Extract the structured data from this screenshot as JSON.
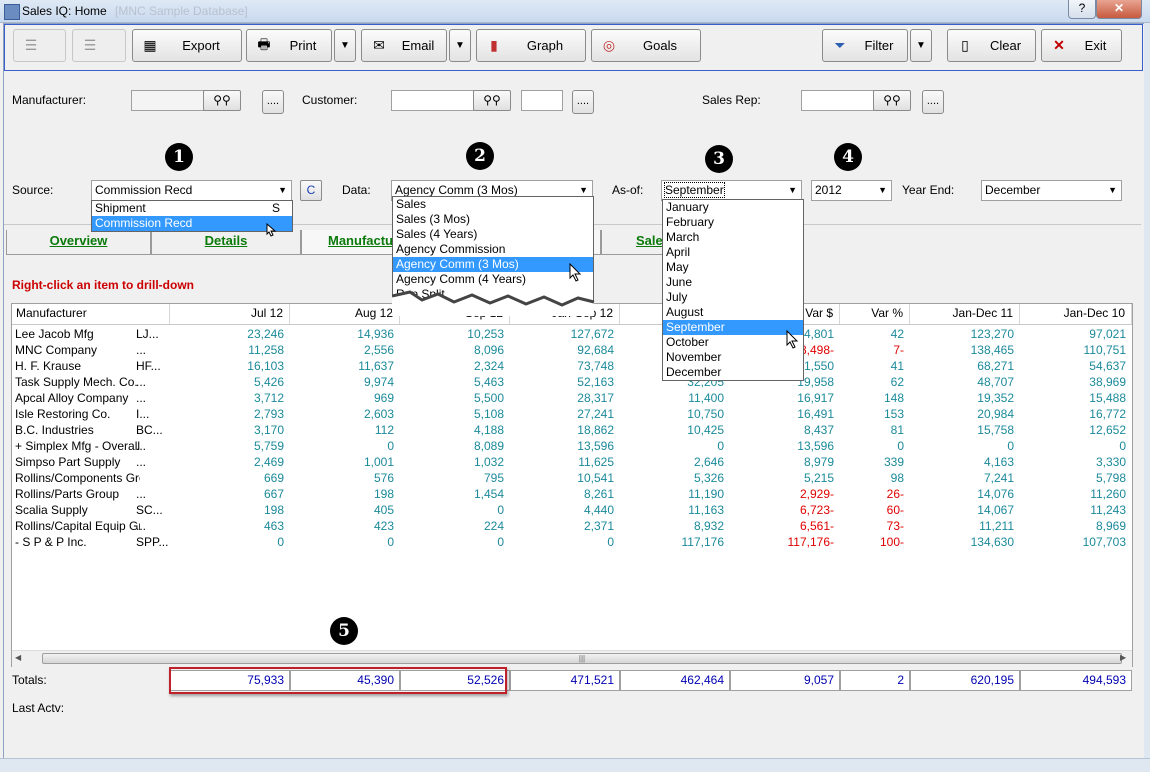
{
  "window": {
    "title": "Sales IQ: Home",
    "title_ghost": "[MNC Sample Database]",
    "help_btn": "?",
    "minimize_btn": "–",
    "close_btn": "✕"
  },
  "toolbar": {
    "export": "Export",
    "print": "Print",
    "email": "Email",
    "graph": "Graph",
    "goals": "Goals",
    "filter": "Filter",
    "clear": "Clear",
    "exit": "Exit",
    "dropdown_arrow": "▼"
  },
  "lookup": {
    "manufacturer_label": "Manufacturer:",
    "customer_label": "Customer:",
    "sales_rep_label": "Sales Rep:",
    "dots": "...."
  },
  "callouts": [
    "1",
    "2",
    "3",
    "4",
    "5"
  ],
  "source": {
    "label": "Source:",
    "value": "Commission Recd",
    "c_button": "C",
    "options": [
      {
        "label": "Shipment",
        "code": "S",
        "selected": false
      },
      {
        "label": "Commission Recd",
        "code": "",
        "selected": true
      }
    ]
  },
  "data_select": {
    "label": "Data:",
    "value": "Agency Comm (3 Mos)",
    "options": [
      "Sales",
      "Sales (3 Mos)",
      "Sales (4 Years)",
      "Agency Commission",
      "Agency Comm (3 Mos)",
      "Agency Comm (4 Years)",
      "Rep Split"
    ],
    "selected_index": 4
  },
  "asof": {
    "label": "As-of:",
    "value": "September",
    "options": [
      "January",
      "February",
      "March",
      "April",
      "May",
      "June",
      "July",
      "August",
      "September",
      "October",
      "November",
      "December"
    ],
    "selected_index": 8
  },
  "year": {
    "value": "2012"
  },
  "year_end": {
    "label": "Year End:",
    "value": "December"
  },
  "tabs": [
    "Overview",
    "Details",
    "Manufacturers",
    "Sales"
  ],
  "hint": "Right-click an item to drill-down",
  "grid": {
    "headers": [
      "Manufacturer",
      "Jul 12",
      "Aug 12",
      "Sep 12",
      "Jan-Sep 12",
      "Jan-Sep 11",
      "Var $",
      "Var %",
      "Jan-Dec 11",
      "Jan-Dec 10"
    ],
    "rows": [
      {
        "name": "Lee Jacob Mfg",
        "code": "LJ...",
        "v": [
          "23,246",
          "14,936",
          "10,253",
          "127,672",
          "",
          "4,801",
          "42",
          "123,270",
          "97,021"
        ],
        "neg": [
          false,
          false,
          false,
          false,
          false,
          false,
          false,
          false,
          false
        ]
      },
      {
        "name": "MNC Company",
        "code": "...",
        "v": [
          "11,258",
          "2,556",
          "8,096",
          "92,684",
          "",
          "8,498-",
          "7-",
          "138,465",
          "110,751"
        ],
        "neg": [
          false,
          false,
          false,
          false,
          false,
          true,
          true,
          false,
          false
        ]
      },
      {
        "name": "H. F. Krause",
        "code": "HF...",
        "v": [
          "16,103",
          "11,637",
          "2,324",
          "73,748",
          "",
          "21,550",
          "41",
          "68,271",
          "54,637"
        ],
        "neg": [
          false,
          false,
          false,
          false,
          false,
          false,
          false,
          false,
          false
        ]
      },
      {
        "name": "Task Supply Mech. Co.",
        "code": "...",
        "v": [
          "5,426",
          "9,974",
          "5,463",
          "52,163",
          "32,205",
          "19,958",
          "62",
          "48,707",
          "38,969"
        ],
        "neg": [
          false,
          false,
          false,
          false,
          false,
          false,
          false,
          false,
          false
        ]
      },
      {
        "name": "Apcal Alloy Company",
        "code": "...",
        "v": [
          "3,712",
          "969",
          "5,500",
          "28,317",
          "11,400",
          "16,917",
          "148",
          "19,352",
          "15,488"
        ],
        "neg": [
          false,
          false,
          false,
          false,
          false,
          false,
          false,
          false,
          false
        ]
      },
      {
        "name": "Isle Restoring Co.",
        "code": "I...",
        "v": [
          "2,793",
          "2,603",
          "5,108",
          "27,241",
          "10,750",
          "16,491",
          "153",
          "20,984",
          "16,772"
        ],
        "neg": [
          false,
          false,
          false,
          false,
          false,
          false,
          false,
          false,
          false
        ]
      },
      {
        "name": "B.C. Industries",
        "code": "BC...",
        "v": [
          "3,170",
          "112",
          "4,188",
          "18,862",
          "10,425",
          "8,437",
          "81",
          "15,758",
          "12,652"
        ],
        "neg": [
          false,
          false,
          false,
          false,
          false,
          false,
          false,
          false,
          false
        ]
      },
      {
        "name": " + Simplex Mfg - Overall",
        "code": "...",
        "v": [
          "5,759",
          "0",
          "8,089",
          "13,596",
          "0",
          "13,596",
          "0",
          "0",
          "0"
        ],
        "neg": [
          false,
          false,
          false,
          false,
          false,
          false,
          false,
          false,
          false
        ]
      },
      {
        "name": "Simpso Part Supply",
        "code": "...",
        "v": [
          "2,469",
          "1,001",
          "1,032",
          "11,625",
          "2,646",
          "8,979",
          "339",
          "4,163",
          "3,330"
        ],
        "neg": [
          false,
          false,
          false,
          false,
          false,
          false,
          false,
          false,
          false
        ]
      },
      {
        "name": "Rollins/Components Grou...",
        "code": "",
        "v": [
          "669",
          "576",
          "795",
          "10,541",
          "5,326",
          "5,215",
          "98",
          "7,241",
          "5,798"
        ],
        "neg": [
          false,
          false,
          false,
          false,
          false,
          false,
          false,
          false,
          false
        ]
      },
      {
        "name": "Rollins/Parts Group",
        "code": "...",
        "v": [
          "667",
          "198",
          "1,454",
          "8,261",
          "11,190",
          "2,929-",
          "26-",
          "14,076",
          "11,260"
        ],
        "neg": [
          false,
          false,
          false,
          false,
          false,
          true,
          true,
          false,
          false
        ]
      },
      {
        "name": "Scalia Supply",
        "code": "SC...",
        "v": [
          "198",
          "405",
          "0",
          "4,440",
          "11,163",
          "6,723-",
          "60-",
          "14,067",
          "11,243"
        ],
        "neg": [
          false,
          false,
          false,
          false,
          false,
          true,
          true,
          false,
          false
        ]
      },
      {
        "name": "Rollins/Capital Equip Grp",
        "code": "...",
        "v": [
          "463",
          "423",
          "224",
          "2,371",
          "8,932",
          "6,561-",
          "73-",
          "11,211",
          "8,969"
        ],
        "neg": [
          false,
          false,
          false,
          false,
          false,
          true,
          true,
          false,
          false
        ]
      },
      {
        "name": " - S P & P Inc.",
        "code": "SPP...",
        "v": [
          "0",
          "0",
          "0",
          "0",
          "117,176",
          "117,176-",
          "100-",
          "134,630",
          "107,703"
        ],
        "neg": [
          false,
          false,
          false,
          false,
          false,
          true,
          true,
          false,
          false
        ]
      }
    ],
    "scroll_grip": "|||"
  },
  "totals": {
    "label": "Totals:",
    "values": [
      "75,933",
      "45,390",
      "52,526",
      "471,521",
      "462,464",
      "9,057",
      "2",
      "620,195",
      "494,593"
    ]
  },
  "last_activity_label": "Last Actv:"
}
